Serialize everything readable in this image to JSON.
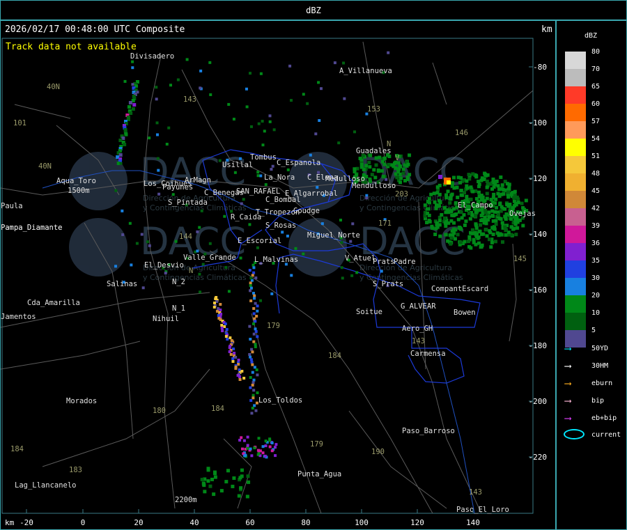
{
  "window_title": "dBZ",
  "header": {
    "timestamp": "2026/02/17 00:48:00 UTC Composite",
    "km_label": "km",
    "track_note": "Track data not available"
  },
  "axes": {
    "x_unit": "km",
    "x_ticks": [
      "-20",
      "0",
      "20",
      "40",
      "60",
      "80",
      "100",
      "120",
      "140"
    ],
    "y_ticks": [
      "-80",
      "-100",
      "-120",
      "-140",
      "-160",
      "-180",
      "-200",
      "-220"
    ]
  },
  "places": [
    "A_Villanueva",
    "Divisadero",
    "Guadales",
    "C_Espanola",
    "Tombus",
    "Usillal",
    "La_Nora",
    "C_Elena",
    "Medulloso",
    "Aqua_Toro",
    "Los_Coihues",
    "Payunes",
    "ArMagn",
    "C_Benegas",
    "SAN_RAFAEL",
    "E_Algarrobal",
    "S_Pintada",
    "C_Bombal",
    "T_Tropezon",
    "Goudge",
    "R_Caida",
    "S_Rosas",
    "Mendulloso",
    "Miguel_Norte",
    "E_Escorial",
    "Valle_Grande",
    "L_Malvinas",
    "V_Atuel",
    "El_Desvio",
    "Salinas",
    "N_2",
    "Cda_Amarilla",
    "N_1",
    "Nihuil",
    "Soitue",
    "G_ALVEAR",
    "Bowen",
    "Aero_GH",
    "Carmensa",
    "Los_Toldos",
    "Morados",
    "Paso_Barroso",
    "Punta_Agua",
    "Lag_Llancanelo",
    "Paso_El_Loro",
    "Jamentos",
    "Paula",
    "Pampa_Diamante",
    "Pampa_Diamante",
    "El_Campo",
    "Ovejas",
    "CompantEscard",
    "Padre",
    "Prats",
    "S_Prats",
    "1500m",
    "2200m"
  ],
  "road_numbers": [
    "143",
    "153",
    "146",
    "101",
    "40N",
    "40N",
    "203",
    "171",
    "144",
    "179",
    "184",
    "180",
    "184",
    "179",
    "190",
    "143",
    "183",
    "184",
    "143",
    "145",
    "N",
    "N",
    "V"
  ],
  "watermark": {
    "logo": "DACC",
    "line1": "Dirección de Agricultura",
    "line2": "y Contingencias Climáticas"
  },
  "legend": {
    "title": "dBZ",
    "levels": [
      {
        "label": "80",
        "color": "#d8d8d8"
      },
      {
        "label": "70",
        "color": "#bcbcbc"
      },
      {
        "label": "65",
        "color": "#ff3a28"
      },
      {
        "label": "60",
        "color": "#ff6a00"
      },
      {
        "label": "57",
        "color": "#ff9a5a"
      },
      {
        "label": "54",
        "color": "#ffff00"
      },
      {
        "label": "51",
        "color": "#f5c83a"
      },
      {
        "label": "48",
        "color": "#f0b030"
      },
      {
        "label": "45",
        "color": "#d08838"
      },
      {
        "label": "42",
        "color": "#c86090"
      },
      {
        "label": "39",
        "color": "#d0189a"
      },
      {
        "label": "36",
        "color": "#8020d0"
      },
      {
        "label": "35",
        "color": "#2040e0"
      },
      {
        "label": "30",
        "color": "#1880e0"
      },
      {
        "label": "20",
        "color": "#008818"
      },
      {
        "label": "10",
        "color": "#006010"
      },
      {
        "label": "5",
        "color": "#504890"
      }
    ],
    "tracks": [
      {
        "label": "50YD",
        "color": "#00e8ff"
      },
      {
        "label": "30HM",
        "color": "#ffffff"
      },
      {
        "label": "eburn",
        "color": "#ffb020"
      },
      {
        "label": "bip",
        "color": "#ffb8d8"
      },
      {
        "label": "eb+bip",
        "color": "#e040ff"
      }
    ],
    "current_label": "current",
    "current_color": "#00e8ff"
  }
}
